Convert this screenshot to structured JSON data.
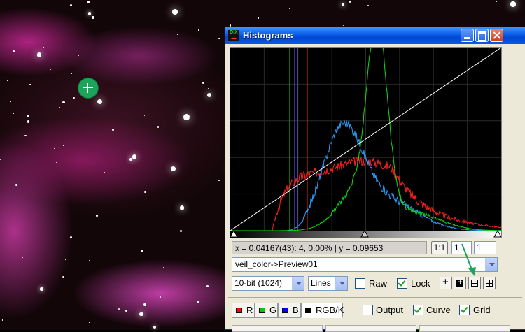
{
  "window": {
    "title": "Histograms",
    "icon_text_top": "DIX",
    "icon_text_bottom": "▬"
  },
  "readout": {
    "text": "x = 0.04167(43): 4, 0.00% | y = 0.09653"
  },
  "zoom": {
    "one_to_one_label": "1:1",
    "x_value": "1",
    "y_value": "1"
  },
  "view": {
    "selected": "veil_color->Preview01"
  },
  "controls": {
    "resolution": "10-bit (1024)",
    "draw_mode": "Lines",
    "raw_label": "Raw",
    "raw_checked": false,
    "lock_label": "Lock",
    "lock_checked": true
  },
  "channels": {
    "r_label": "R",
    "g_label": "G",
    "b_label": "B",
    "rgbk_label": "RGB/K",
    "r_color": "#ff0000",
    "g_color": "#00cc00",
    "b_color": "#0000ff",
    "rgbk_color": "#000000"
  },
  "options": {
    "output_label": "Output",
    "output_checked": false,
    "curve_label": "Curve",
    "curve_checked": true,
    "grid_label": "Grid",
    "grid_checked": true
  },
  "colors": {
    "red": "#ff2020",
    "green": "#10e010",
    "blue": "#2aa0ff",
    "titlebar": "#0a5ae8"
  }
}
